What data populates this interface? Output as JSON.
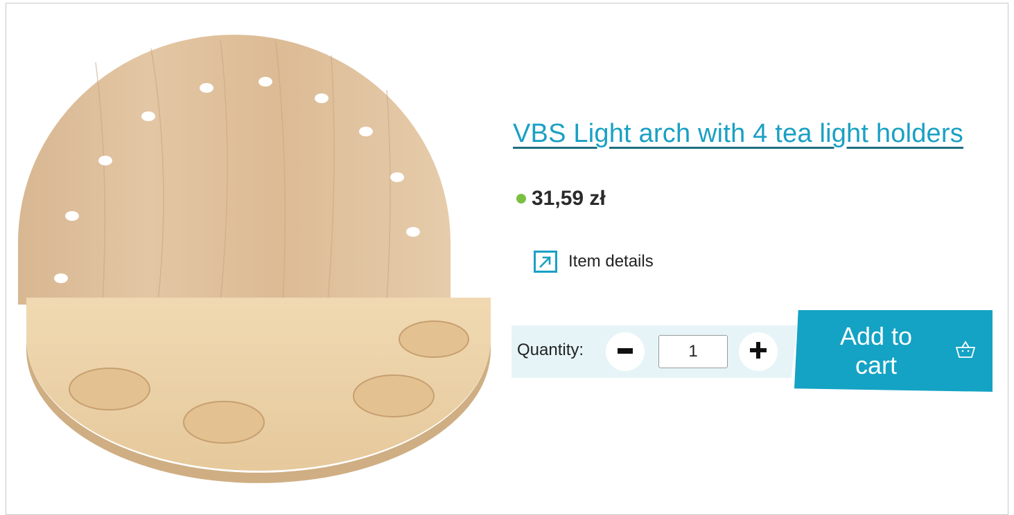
{
  "product": {
    "title": "VBS Light arch with 4 tea light holders",
    "price": "31,59 zł",
    "stock_color": "#7ac143",
    "details_label": "Item details",
    "details_icon": "external-link-arrow-icon"
  },
  "cart": {
    "quantity_label": "Quantity:",
    "quantity_value": "1",
    "minus_icon": "minus-icon",
    "plus_icon": "plus-icon",
    "add_label_line1": "Add to",
    "add_label_line2": "cart",
    "basket_icon": "basket-icon"
  },
  "colors": {
    "accent": "#14a3c4",
    "title_link": "#1aa0c4",
    "underline": "#1f6f7e",
    "quantity_band": "#e6f4f8"
  }
}
